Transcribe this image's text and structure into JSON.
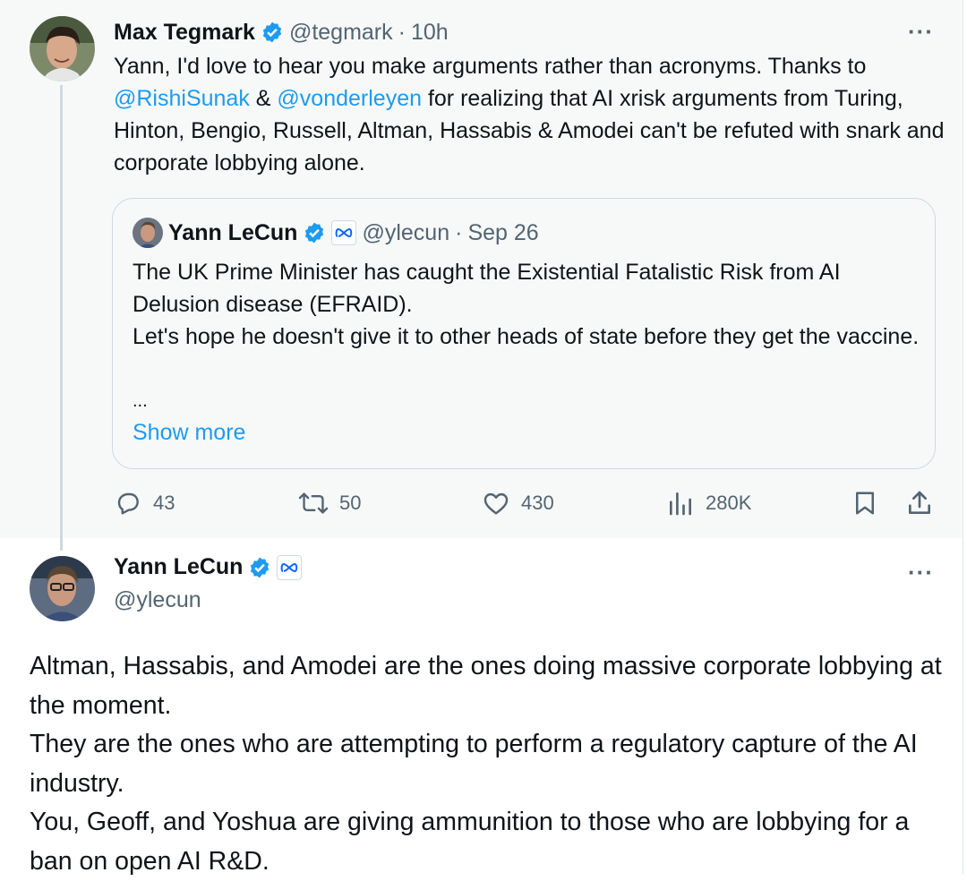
{
  "first_tweet": {
    "author_name": "Max Tegmark",
    "handle": "@tegmark",
    "separator": "·",
    "time": "10h",
    "more_label": "···",
    "text_part1": "Yann, I'd love to hear you make arguments rather than acronyms. Thanks to ",
    "mention1": "@RishiSunak",
    "text_part2": " & ",
    "mention2": "@vonderleyen",
    "text_part3": " for realizing that AI xrisk arguments  from Turing, Hinton, Bengio, Russell, Altman, Hassabis & Amodei can't be refuted with snark and corporate lobbying alone."
  },
  "quoted_tweet": {
    "author_name": "Yann LeCun",
    "handle": "@ylecun",
    "separator": "·",
    "date": "Sep 26",
    "line1": "The UK Prime Minister has caught the Existential Fatalistic Risk from AI Delusion disease (EFRAID).",
    "line2": "Let's hope he doesn't give it to other heads of state before they get the vaccine.",
    "ellipsis": "...",
    "show_more": "Show more"
  },
  "actions": {
    "replies": "43",
    "retweets": "50",
    "likes": "430",
    "views": "280K"
  },
  "second_tweet": {
    "author_name": "Yann LeCun",
    "handle": "@ylecun",
    "more_label": "···",
    "paragraphs": [
      "Altman, Hassabis, and Amodei are the ones doing massive corporate lobbying at the moment.",
      "They are the ones who are attempting to perform a regulatory capture of the AI industry.",
      "You, Geoff, and Yoshua are giving ammunition to those who are lobbying for a ban on open AI R&D."
    ]
  },
  "colors": {
    "accent_blue": "#1d9bf0",
    "muted_gray": "#536471",
    "text": "#0f1419",
    "highlight_bg": "#f7f9f9"
  },
  "icons": [
    "verified-badge-icon",
    "meta-affiliation-icon",
    "reply-icon",
    "retweet-icon",
    "like-icon",
    "views-icon",
    "bookmark-icon",
    "share-icon",
    "more-icon"
  ]
}
